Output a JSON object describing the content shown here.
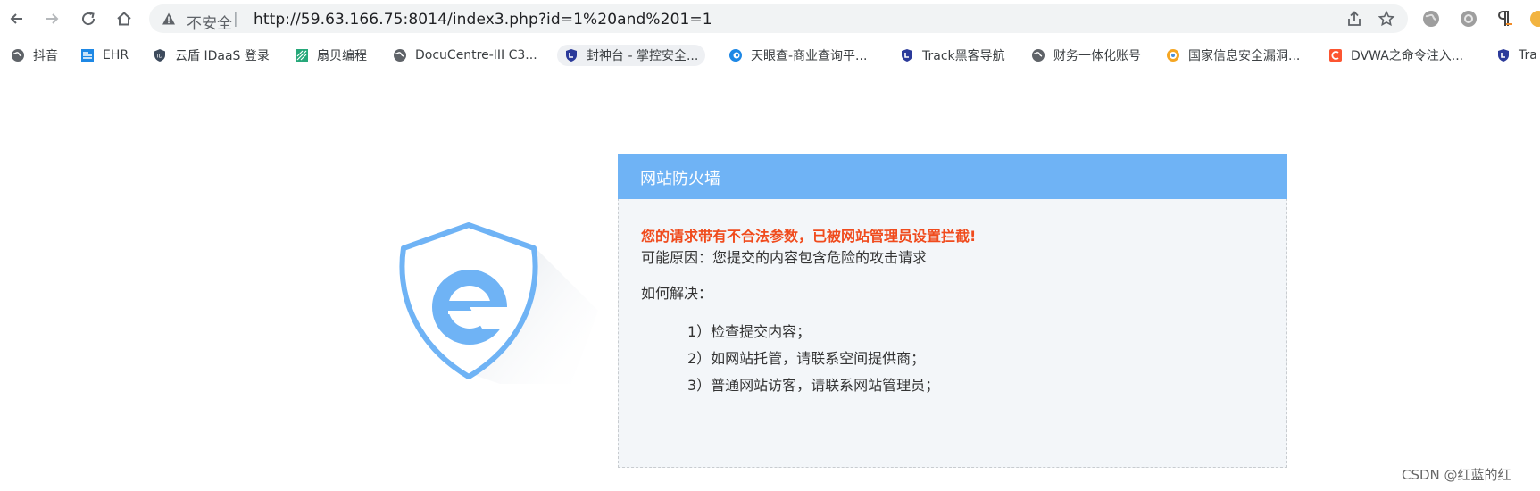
{
  "browser": {
    "security_label": "不安全",
    "separator": "|",
    "url": "http://59.63.166.75:8014/index3.php?id=1%20and%201=1"
  },
  "bookmarks": [
    {
      "label": "抖音",
      "icon": "globe-icon"
    },
    {
      "label": "EHR",
      "icon": "ehr-icon"
    },
    {
      "label": "云盾 IDaaS 登录",
      "icon": "idaas-icon"
    },
    {
      "label": "扇贝编程",
      "icon": "shanbay-icon"
    },
    {
      "label": "DocuCentre-III C3...",
      "icon": "globe-icon"
    },
    {
      "label": "封神台 - 掌控安全...",
      "icon": "shield-bookmark-icon"
    },
    {
      "label": "天眼查-商业查询平...",
      "icon": "tianyancha-icon"
    },
    {
      "label": "Track黑客导航",
      "icon": "shield-bookmark-icon"
    },
    {
      "label": "财务一体化账号",
      "icon": "globe-icon"
    },
    {
      "label": "国家信息安全漏洞...",
      "icon": "cnnvd-icon"
    },
    {
      "label": "DVWA之命令注入...",
      "icon": "csdn-icon"
    },
    {
      "label": "Tra",
      "icon": "shield-bookmark-icon"
    }
  ],
  "page": {
    "title": "网站防火墙",
    "alert": "您的请求带有不合法参数，已被网站管理员设置拦截!",
    "reason": "可能原因：您提交的内容包含危险的攻击请求",
    "howto": "如何解决：",
    "steps": [
      "1）检查提交内容；",
      "2）如网站托管，请联系空间提供商；",
      "3）普通网站访客，请联系网站管理员；"
    ],
    "watermark": "CSDN @红蓝的红"
  },
  "colors": {
    "header_blue": "#6fb3f5",
    "alert_red": "#f04b1d",
    "logo_blue": "#6fb3f5"
  }
}
